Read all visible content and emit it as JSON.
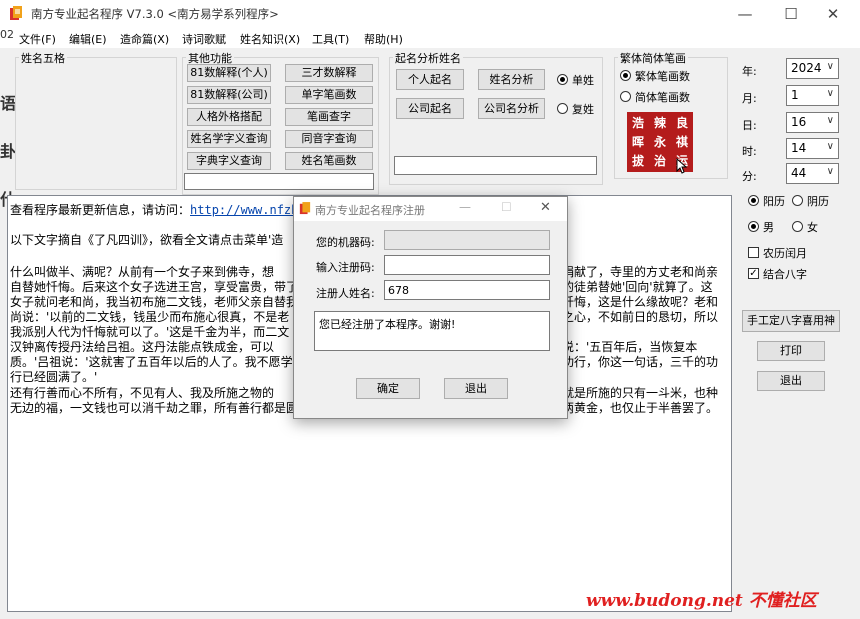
{
  "window": {
    "title": "南方专业起名程序 V7.3.0  <南方易学系列程序>",
    "minimize": "—",
    "maximize": "☐",
    "close": "✕"
  },
  "menu": [
    "文件(F)",
    "编辑(E)",
    "造命篇(X)",
    "诗词歌赋",
    "姓名知识(X)",
    "工具(T)",
    "帮助(H)"
  ],
  "groups": {
    "wuge": "姓名五格",
    "other_functions": "其他功能",
    "analysis": "起名分析姓名",
    "fanjian": "繁体简体笔画"
  },
  "function_buttons": [
    [
      "81数解释(个人)",
      "三才数解释"
    ],
    [
      "81数解释(公司)",
      "单字笔画数"
    ],
    [
      "人格外格搭配",
      "笔画查字"
    ],
    [
      "姓名学字义查询",
      "同音字查询"
    ],
    [
      "字典字义查询",
      "姓名笔画数"
    ]
  ],
  "analysis_buttons": {
    "personal_naming": "个人起名",
    "name_analysis": "姓名分析",
    "company_naming": "公司起名",
    "company_analysis": "公司名分析"
  },
  "surname_type": {
    "single": "单姓",
    "double": "复姓",
    "selected": "单姓"
  },
  "stroke_type": {
    "traditional": "繁体笔画数",
    "simplified": "简体笔画数",
    "selected": "繁体笔画数"
  },
  "seal_chars": [
    "浩",
    "辣",
    "良",
    "晖",
    "永",
    "祺",
    "拔",
    "治",
    "运"
  ],
  "date": {
    "year_label": "年:",
    "year": "2024",
    "month_label": "月:",
    "month": "1",
    "day_label": "日:",
    "day": "16",
    "hour_label": "时:",
    "hour": "14",
    "minute_label": "分:",
    "minute": "44"
  },
  "calendar": {
    "solar": "阳历",
    "lunar": "阴历",
    "selected": "阳历"
  },
  "gender": {
    "male": "男",
    "female": "女",
    "selected": "男"
  },
  "options": {
    "lunar_leap": "农历闰月",
    "lunar_leap_checked": false,
    "combine_bazi": "结合八字",
    "combine_bazi_checked": true
  },
  "side_buttons": {
    "manual_bazi": "手工定八字喜用神",
    "print": "打印",
    "exit": "退出"
  },
  "document": {
    "line1_text": "查看程序最新更新信息，请访问：",
    "line1_link": "http://www.nfzhou",
    "line2": "以下文字摘自《了凡四训》，欲看全文请点击菜单'造",
    "paragraph_lines": [
      "    什么叫做半、满呢？从前有一个女子来到佛寺，想",
      "自替她忏悔。后来这个女子选进王宫，享受富贵，带了",
      "女子就问老和尚，我当初布施二文钱，老师父亲自替我",
      "尚说：'以前的二文钱，钱虽少而布施心很真，不是老",
      "我派别人代为忏悔就可以了。'这是千金为半，而二文",
      "    汉钟离传授丹法给吕祖。这丹法能点铁成金，可以",
      "质。'吕祖说：'这就害了五百年以后的人了。我不愿学",
      "行已经圆满了。'",
      "    还有行善而心不所有，不见有人、我及所施之物的",
      "无边的福，一文钱也可以消千劫之罪，所有善行都是圆"
    ],
    "right_fragments": [
      "捐献了，寺里的方丈老和尚亲",
      "的徒弟替她'回向'就算了。这",
      "忏悔，这是什么缘故呢？老和",
      "之心，不如前日的恳切，所以",
      "说：'五百年后，当恢复本",
      "功行，你这一句话，三千的功",
      "就是所施的只有一斗米，也种",
      "两黄金，也仅止于半善罢了。"
    ]
  },
  "dialog": {
    "title": "南方专业起名程序注册",
    "minimize": "—",
    "maximize": "☐",
    "close": "✕",
    "machine_code_label": "您的机器码:",
    "machine_code_value": "",
    "reg_code_label": "输入注册码:",
    "reg_code_value": "",
    "reg_name_label": "注册人姓名:",
    "reg_name_value": "678",
    "message": "您已经注册了本程序。谢谢!",
    "ok": "确定",
    "exit": "退出"
  },
  "watermark": "www.budong.net 不懂社区",
  "left_edge_glyphs": [
    "02",
    "语",
    "卦",
    "什"
  ]
}
